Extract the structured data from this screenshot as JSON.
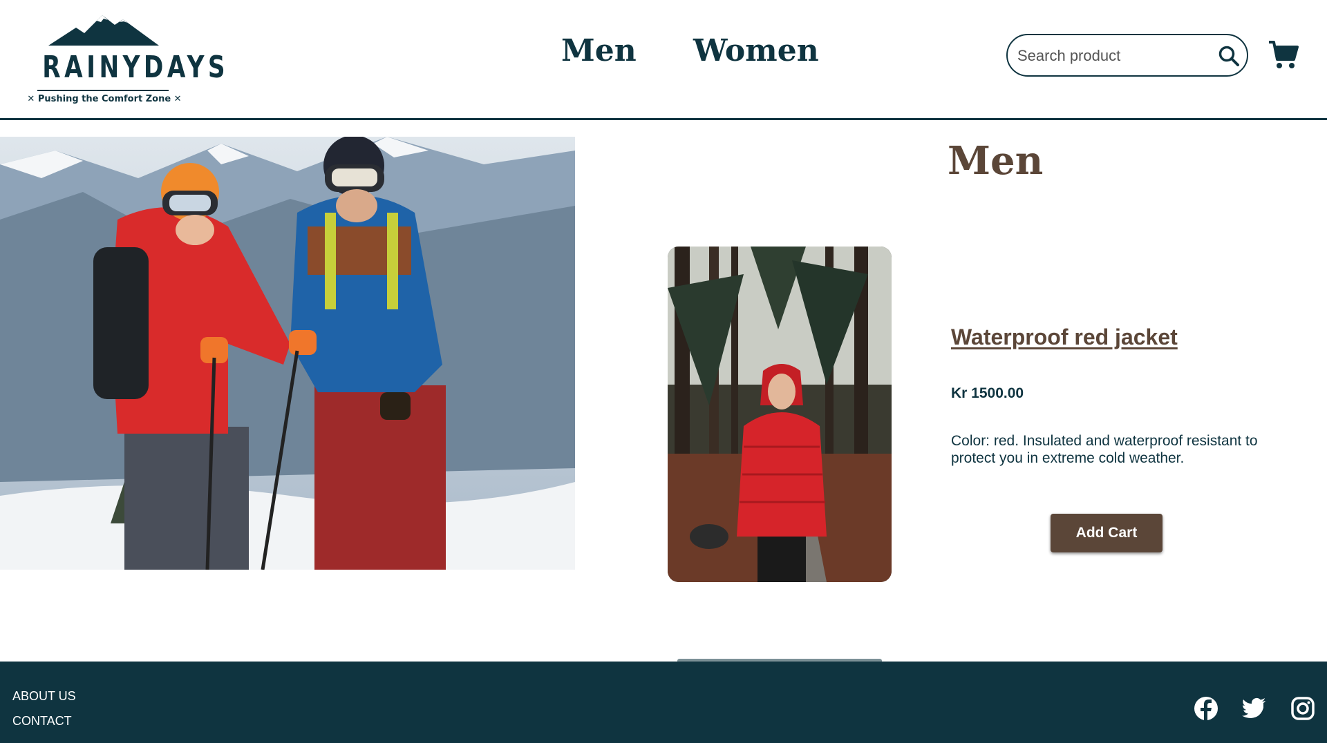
{
  "header": {
    "logo": {
      "wordmark": "RAINYDAYS",
      "tagline": "✕ Pushing the Comfort Zone ✕"
    },
    "nav": [
      {
        "label": "Men"
      },
      {
        "label": "Women"
      }
    ],
    "search": {
      "placeholder": "Search product",
      "value": ""
    },
    "icons": {
      "search": "search-icon",
      "cart": "shopping-cart-icon"
    }
  },
  "main": {
    "section_title": "Men",
    "product": {
      "name": "Waterproof red jacket",
      "price": "Kr 1500.00",
      "description": "Color: red. Insulated and waterproof resistant to protect you in extreme cold weather.",
      "add_cart_label": "Add Cart"
    }
  },
  "footer": {
    "links": [
      {
        "label": "ABOUT US"
      },
      {
        "label": "CONTACT"
      }
    ],
    "social": [
      "facebook-icon",
      "twitter-icon",
      "instagram-icon"
    ]
  },
  "colors": {
    "brand_dark": "#0f3440",
    "accent_brown": "#5b4638",
    "background": "#ffffff"
  }
}
